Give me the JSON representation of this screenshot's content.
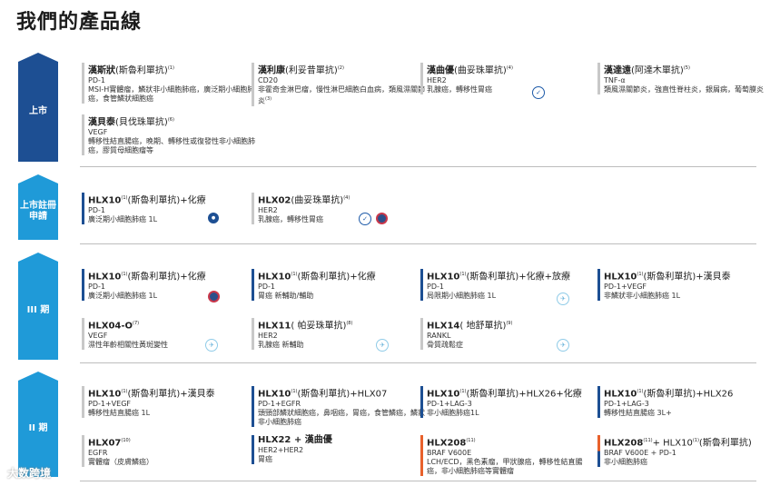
{
  "page": {
    "title": "我們的產品線"
  },
  "stages": {
    "launched": "上市",
    "nda": "上市註冊\n申請",
    "phase3": "III 期",
    "phase2": "II 期"
  },
  "colors": {
    "launched": "#1d4f93",
    "nda": "#1f9ad8",
    "card_bar_gray": "#c8c8c8",
    "card_bar_navy": "#1d4f93",
    "card_bar_orange": "#e8612c"
  },
  "cards": {
    "c1": {
      "name": "漢斯狀",
      "sub": "(斯魯利單抗)",
      "note": "(1)",
      "line2": "PD-1",
      "line3": "MSI-H實體瘤，鱗狀非小細胞肺癌，廣泛期小細胞肺癌，食管鱗狀細胞癌"
    },
    "c2": {
      "name": "漢利康",
      "sub": "(利妥昔單抗)",
      "note": "(2)",
      "line2": "CD20",
      "line3": "非霍奇金淋巴瘤，慢性淋巴細胞白血病，類風濕關節炎",
      "note2": "(3)"
    },
    "c3": {
      "name": "漢曲優",
      "sub": "(曲妥珠單抗)",
      "note": "(4)",
      "line2": "HER2",
      "line3": "乳腺癌，轉移性胃癌"
    },
    "c4": {
      "name": "漢達遠",
      "sub": "(阿達木單抗)",
      "note": "(5)",
      "line2": "TNF-α",
      "line3": "類風濕關節炎，強直性脊柱炎，銀屑病，葡萄膜炎"
    },
    "c5": {
      "name": "漢貝泰",
      "sub": "(貝伐珠單抗)",
      "note": "(6)",
      "line2": "VEGF",
      "line3": "轉移性結直腸癌，晚期、轉移性或復發性非小細胞肺癌，膠質母細胞瘤等"
    },
    "c6": {
      "name": "HLX10",
      "sub": "(斯魯利單抗)+化療",
      "note": "(1)",
      "line2": "PD-1",
      "line3": "廣泛期小細胞肺癌 1L"
    },
    "c7": {
      "name": "HLX02",
      "sub": "(曲妥珠單抗)",
      "note": "(4)",
      "line2": "HER2",
      "line3": "乳腺癌，轉移性胃癌"
    },
    "c8": {
      "name": "HLX10",
      "sub": "(斯魯利單抗)+化療",
      "note": "(1)",
      "line2": "PD-1",
      "line3": "廣泛期小細胞肺癌 1L"
    },
    "c9": {
      "name": "HLX10",
      "sub": "(斯魯利單抗)+化療",
      "note": "(1)",
      "line2": "PD-1",
      "line3": "胃癌 新輔助/輔助"
    },
    "c10": {
      "name": "HLX10",
      "sub": "(斯魯利單抗)+化療+放療",
      "note": "(1)",
      "line2": "PD-1",
      "line3": "局限期小細胞肺癌 1L"
    },
    "c11": {
      "name": "HLX10",
      "sub": "(斯魯利單抗)+漢貝泰",
      "note": "(1)",
      "line2": "PD-1+VEGF",
      "line3": "非鱗狀非小細胞肺癌 1L"
    },
    "c12": {
      "name": "HLX04-O",
      "sub": "",
      "note": "(7)",
      "line2": "VEGF",
      "line3": "濕性年齡相關性黃斑變性"
    },
    "c13": {
      "name": "HLX11",
      "sub": "( 帕妥珠單抗)",
      "note": "(8)",
      "line2": "HER2",
      "line3": "乳腺癌 新輔助"
    },
    "c14": {
      "name": "HLX14",
      "sub": "( 地舒單抗)",
      "note": "(9)",
      "line2": "RANKL",
      "line3": "骨質疏鬆症"
    },
    "c15": {
      "name": "HLX10",
      "sub": "(斯魯利單抗)+漢貝泰",
      "note": "(1)",
      "line2": "PD-1+VEGF",
      "line3": "轉移性結直腸癌 1L"
    },
    "c16": {
      "name": "HLX10",
      "sub": "(斯魯利單抗)+HLX07",
      "note": "(1)",
      "line2": "PD-1+EGFR",
      "line3": "頭頸部鱗狀細胞癌，鼻咽癌，胃癌，食管鱗癌，鱗狀非小細胞肺癌"
    },
    "c17": {
      "name": "HLX10",
      "sub": "(斯魯利單抗)+HLX26+化療",
      "note": "(1)",
      "line2": "PD-1+LAG-3",
      "line3": "非小細胞肺癌1L"
    },
    "c18": {
      "name": "HLX10",
      "sub": "(斯魯利單抗)+HLX26",
      "note": "(1)",
      "line2": "PD-1+LAG-3",
      "line3": "轉移性結直腸癌 3L+"
    },
    "c19": {
      "name": "HLX07",
      "sub": "",
      "note": "(10)",
      "line2": "EGFR",
      "line3": "實體瘤（皮膚鱗癌）"
    },
    "c20": {
      "name": "HLX22 + 漢曲優",
      "sub": "",
      "note": "",
      "line2": "HER2+HER2",
      "line3": "胃癌"
    },
    "c21": {
      "name": "HLX208",
      "sub": "",
      "note": "(11)",
      "line2": "BRAF V600E",
      "line3": "LCH/ECD，黑色素瘤，甲狀腺癌，轉移性結直腸癌，非小細胞肺癌等實體瘤"
    },
    "c22": {
      "name": "HLX208",
      "sub": "+ HLX10",
      "note": "(11)",
      "sub2": "(斯魯利單抗)",
      "line2": "BRAF V600E + PD-1",
      "line3": "非小細胞肺癌"
    }
  },
  "watermark": "大数跨境"
}
